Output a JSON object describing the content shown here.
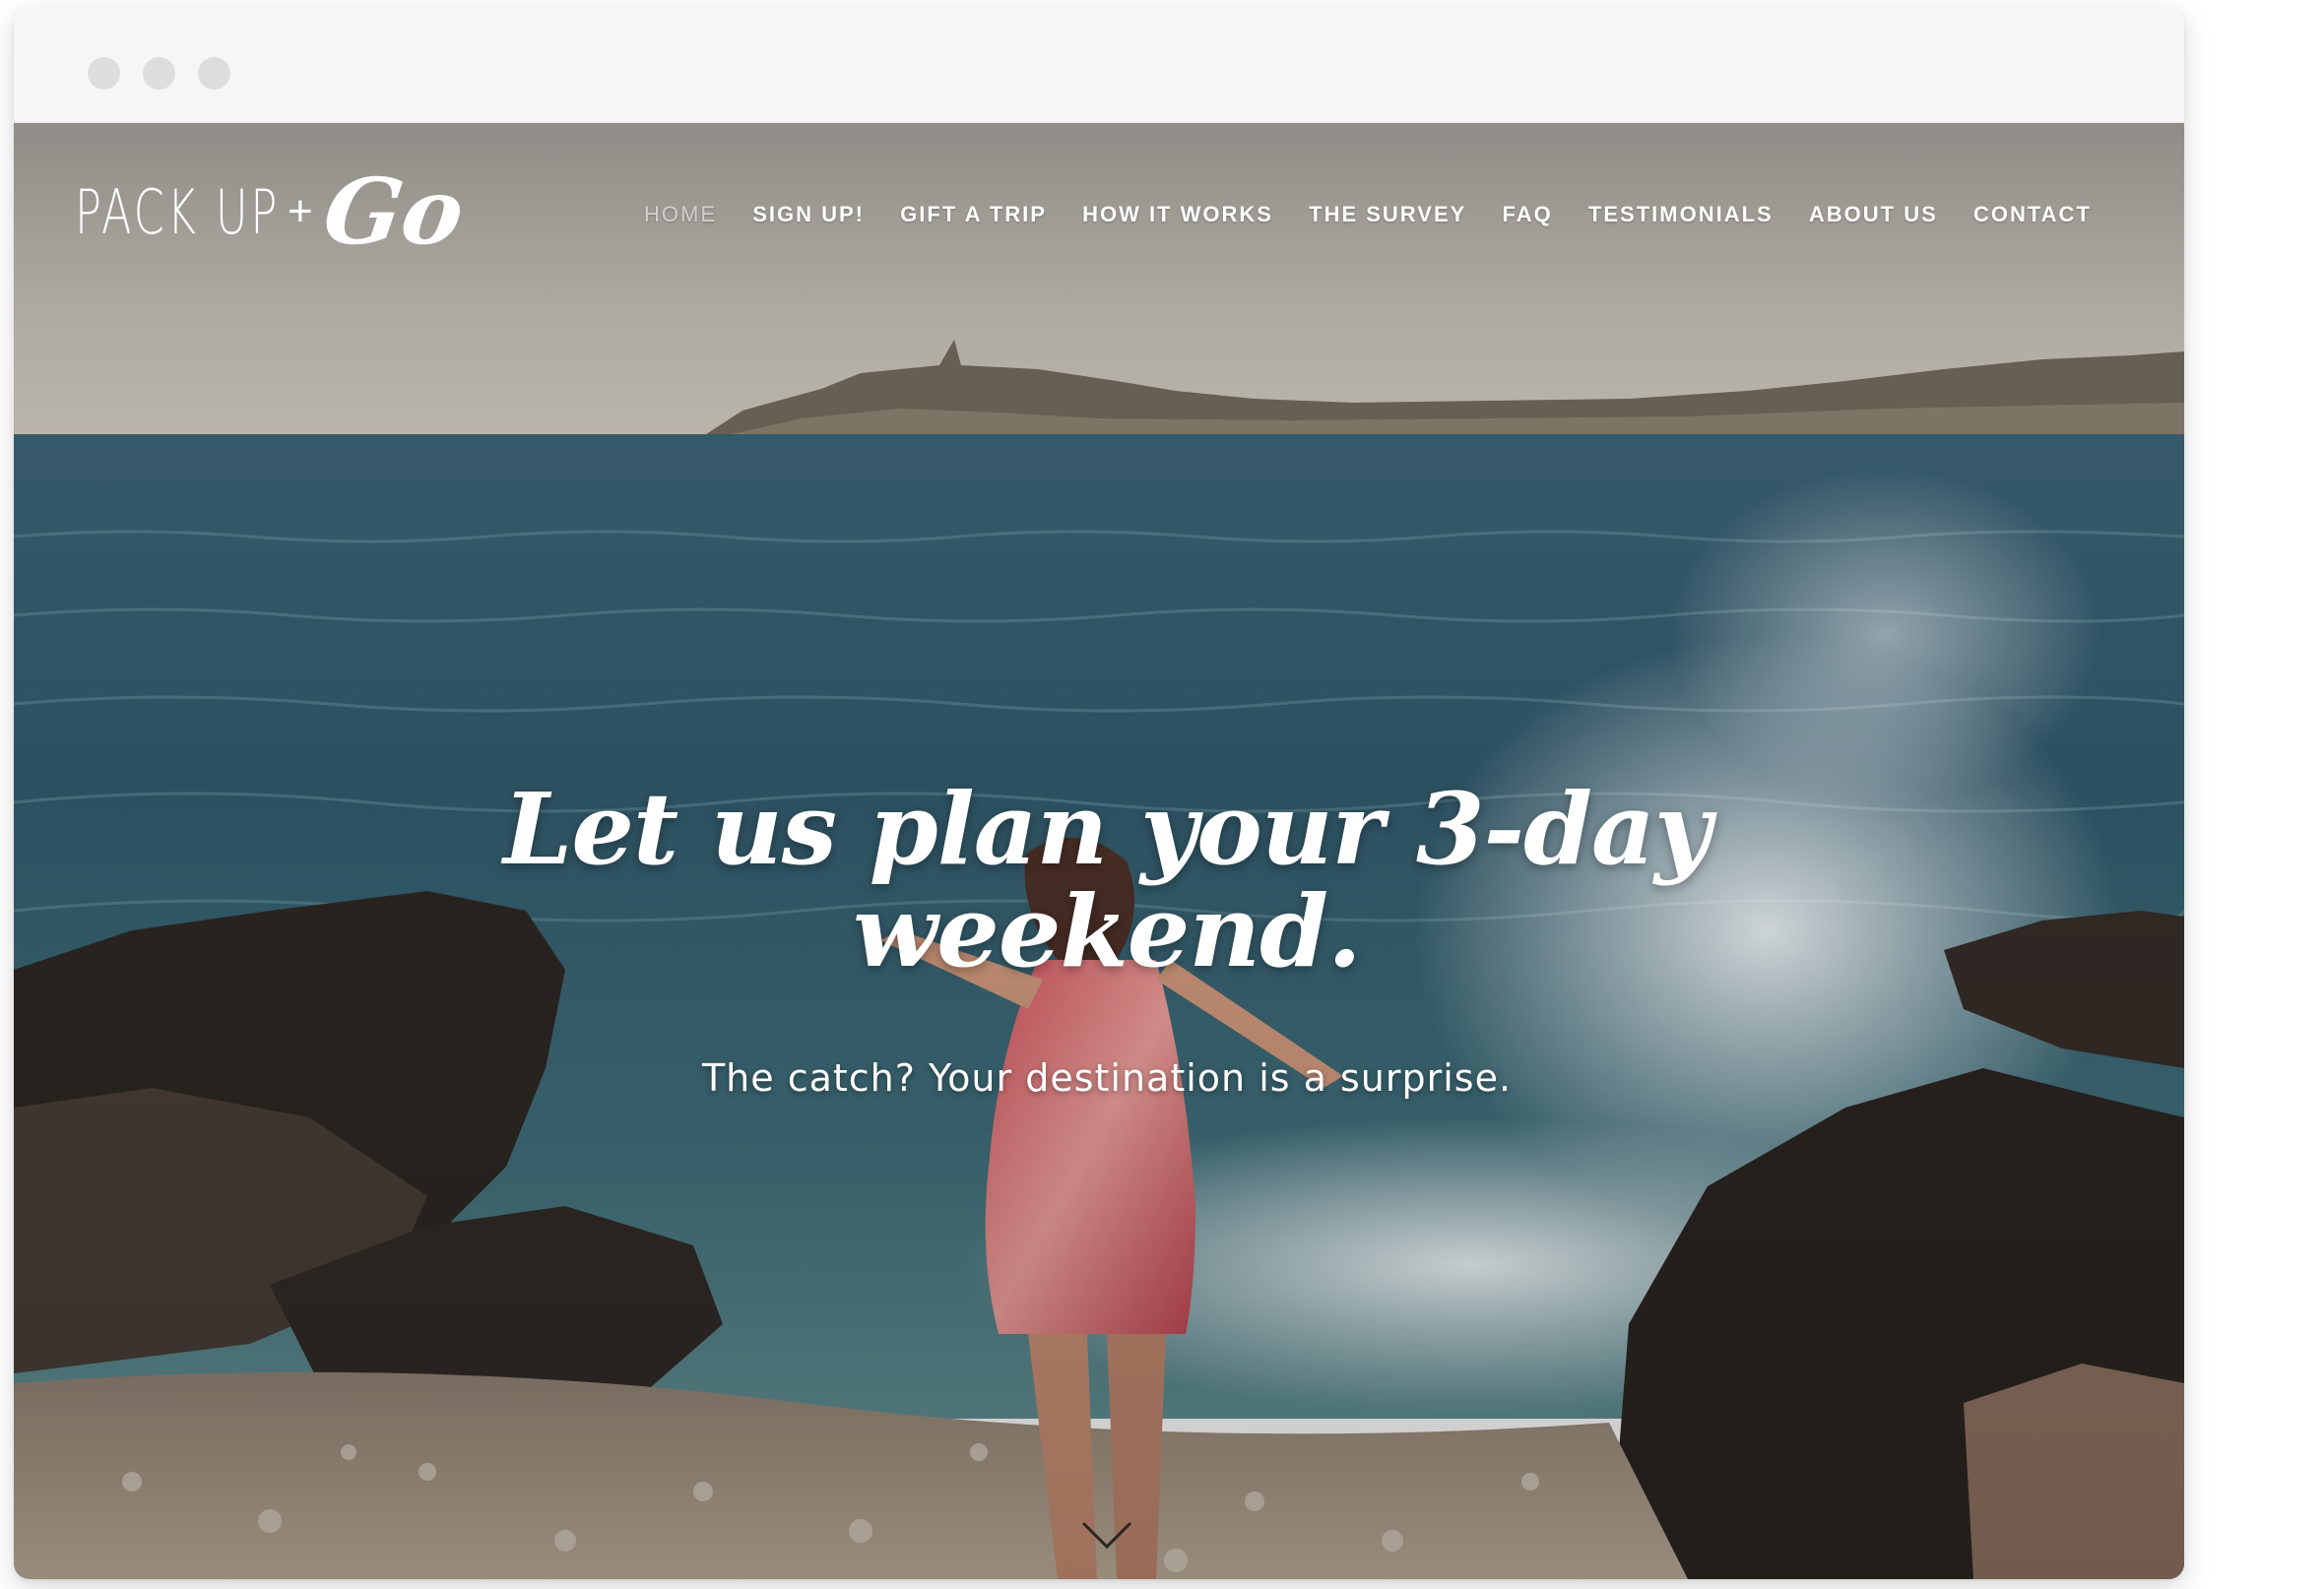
{
  "site": {
    "logo": {
      "text_main": "PACK UP",
      "plus": "+",
      "text_script": "Go"
    },
    "nav": [
      {
        "label": "HOME",
        "active": true
      },
      {
        "label": "SIGN UP!"
      },
      {
        "label": "GIFT A TRIP"
      },
      {
        "label": "HOW IT WORKS"
      },
      {
        "label": "THE SURVEY"
      },
      {
        "label": "FAQ"
      },
      {
        "label": "TESTIMONIALS"
      },
      {
        "label": "ABOUT US"
      },
      {
        "label": "CONTACT"
      }
    ]
  },
  "hero": {
    "headline_line1": "Let us plan your 3-day",
    "headline_line2": "weekend.",
    "subheadline": "The catch? Your destination is a surprise.",
    "scroll_icon": "chevron-down-icon"
  },
  "colors": {
    "chrome_bg": "#f6f6f6",
    "traffic_light": "#dddddd",
    "nav_text": "#ffffff",
    "sea": "#2c5566",
    "sky": "#b7b2aa"
  }
}
